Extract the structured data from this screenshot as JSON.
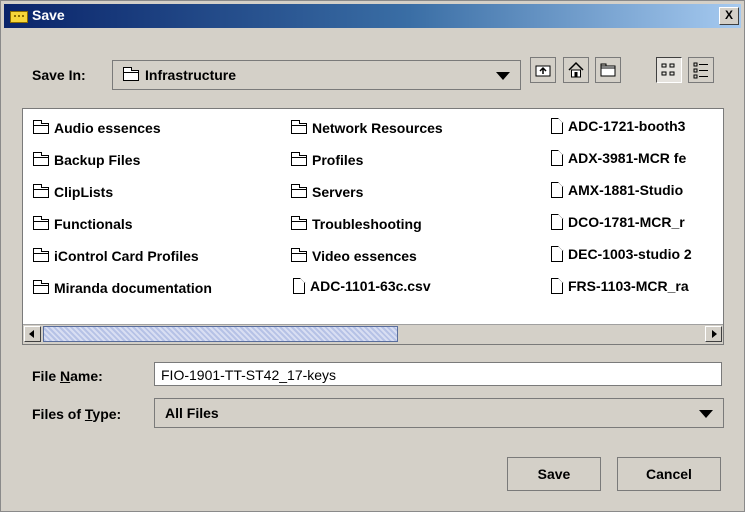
{
  "window": {
    "title": "Save",
    "close_label": "X"
  },
  "save_in": {
    "label": "Save In:",
    "value": "Infrastructure"
  },
  "toolbar": {
    "buttons": [
      "up-one-level",
      "home",
      "new-folder",
      "list-view",
      "details-view"
    ]
  },
  "files": {
    "col1": [
      {
        "name": "Audio essences",
        "type": "folder"
      },
      {
        "name": "Backup Files",
        "type": "folder"
      },
      {
        "name": "ClipLists",
        "type": "folder"
      },
      {
        "name": "Functionals",
        "type": "folder"
      },
      {
        "name": "iControl Card Profiles",
        "type": "folder"
      },
      {
        "name": "Miranda documentation",
        "type": "folder"
      }
    ],
    "col2": [
      {
        "name": "Network Resources",
        "type": "folder"
      },
      {
        "name": "Profiles",
        "type": "folder"
      },
      {
        "name": "Servers",
        "type": "folder"
      },
      {
        "name": "Troubleshooting",
        "type": "folder"
      },
      {
        "name": "Video essences",
        "type": "folder"
      },
      {
        "name": "ADC-1101-63c.csv",
        "type": "file"
      }
    ],
    "col3": [
      {
        "name": "ADC-1721-booth3",
        "type": "file"
      },
      {
        "name": "ADX-3981-MCR fe",
        "type": "file"
      },
      {
        "name": "AMX-1881-Studio",
        "type": "file"
      },
      {
        "name": "DCO-1781-MCR_r",
        "type": "file"
      },
      {
        "name": "DEC-1003-studio 2",
        "type": "file"
      },
      {
        "name": "FRS-1103-MCR_ra",
        "type": "file"
      }
    ]
  },
  "file_name": {
    "label": "File Name:",
    "value": "FIO-1901-TT-ST42_17-keys"
  },
  "files_of_type": {
    "label": "Files of Type:",
    "value": "All Files"
  },
  "buttons": {
    "save": "Save",
    "cancel": "Cancel"
  },
  "colors": {
    "title_start": "#0a246a",
    "title_end": "#a6caf0",
    "window_bg": "#d4d0c8"
  }
}
